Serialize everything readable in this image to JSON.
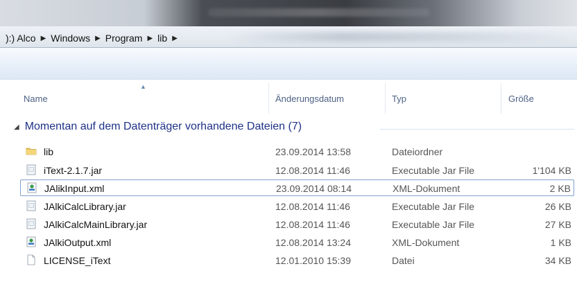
{
  "breadcrumb": [
    "):) Alco",
    "Windows",
    "Program",
    "lib"
  ],
  "columns": {
    "name": "Name",
    "date": "Änderungsdatum",
    "type": "Typ",
    "size": "Größe"
  },
  "group": {
    "label": "Momentan auf dem Datenträger vorhandene Dateien (7)"
  },
  "files": [
    {
      "name": "lib",
      "date": "23.09.2014 13:58",
      "type": "Dateiordner",
      "size": "",
      "icon": "folder-icon"
    },
    {
      "name": "iText-2.1.7.jar",
      "date": "12.08.2014 11:46",
      "type": "Executable Jar File",
      "size": "1'104 KB",
      "icon": "jar-file-icon"
    },
    {
      "name": "JAlikInput.xml",
      "date": "23.09.2014 08:14",
      "type": "XML-Dokument",
      "size": "2 KB",
      "icon": "xml-file-icon"
    },
    {
      "name": "JAlkiCalcLibrary.jar",
      "date": "12.08.2014 11:46",
      "type": "Executable Jar File",
      "size": "26 KB",
      "icon": "jar-file-icon"
    },
    {
      "name": "JAlkiCalcMainLibrary.jar",
      "date": "12.08.2014 11:46",
      "type": "Executable Jar File",
      "size": "27 KB",
      "icon": "jar-file-icon"
    },
    {
      "name": "JAlkiOutput.xml",
      "date": "12.08.2014 13:24",
      "type": "XML-Dokument",
      "size": "1 KB",
      "icon": "xml-file-icon"
    },
    {
      "name": "LICENSE_iText",
      "date": "12.01.2010 15:39",
      "type": "Datei",
      "size": "34 KB",
      "icon": "blank-file-icon"
    }
  ],
  "selected_index": 2,
  "colors": {
    "group_text": "#1e3287",
    "header_text": "#4d6185",
    "selection_border": "#7da2ce"
  }
}
